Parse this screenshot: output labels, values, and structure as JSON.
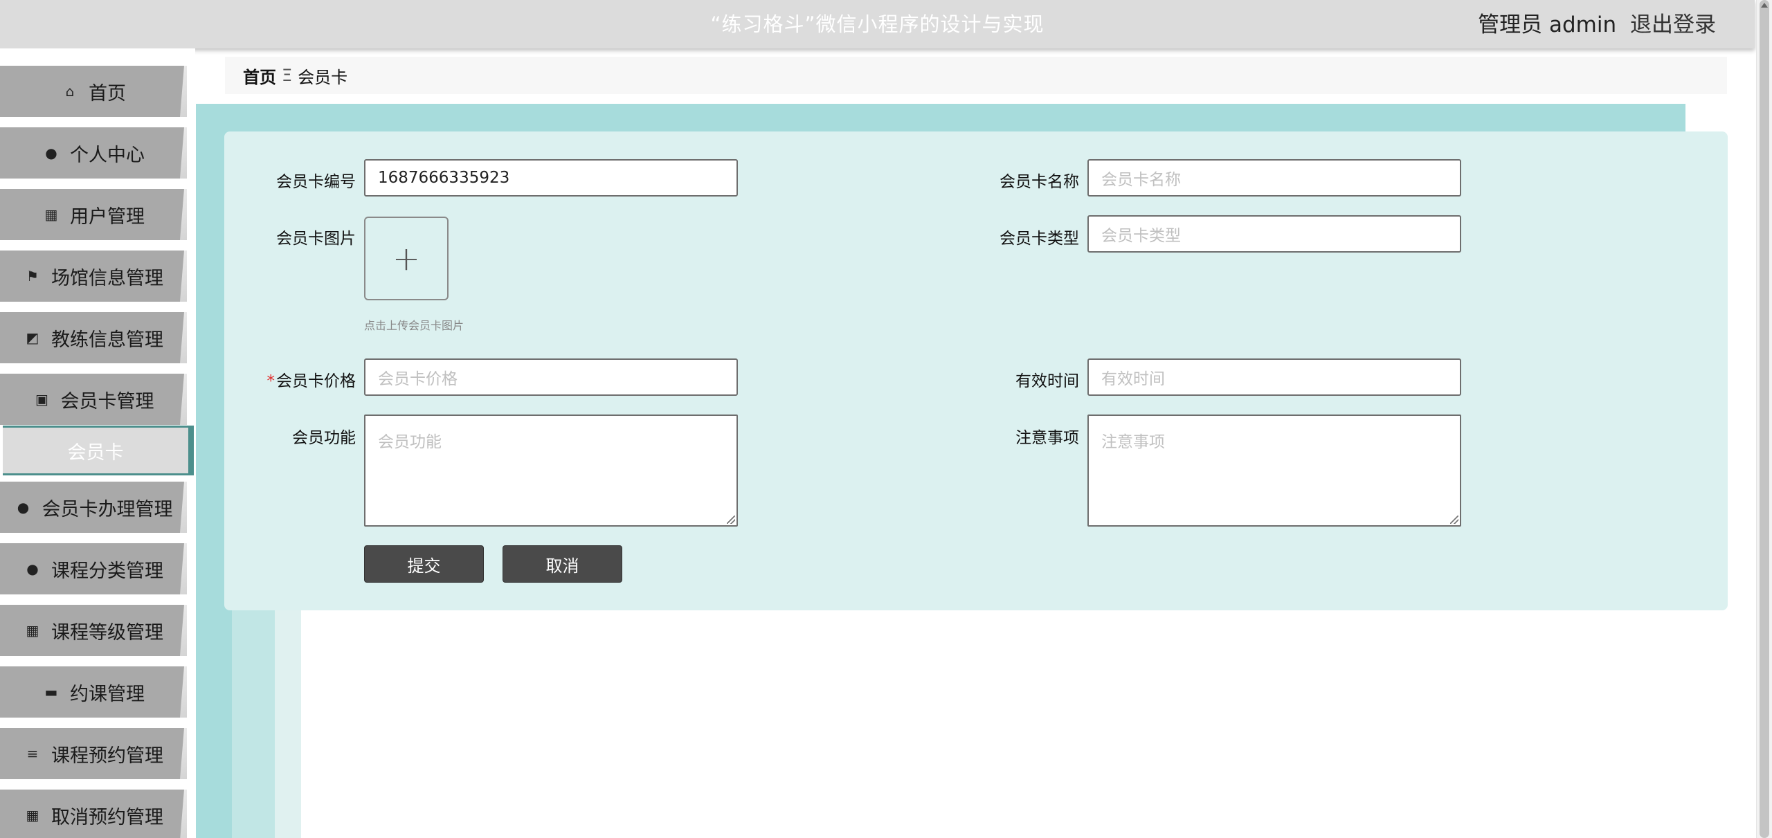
{
  "header": {
    "title": "“练习格斗”微信小程序的设计与实现",
    "user_label": "管理员 admin",
    "logout_label": "退出登录"
  },
  "sidebar": {
    "items": [
      {
        "label": "首页",
        "icon": "home-icon",
        "glyph": "⌂"
      },
      {
        "label": "个人中心",
        "icon": "user-icon",
        "glyph": "●"
      },
      {
        "label": "用户管理",
        "icon": "grid-icon",
        "glyph": "▦"
      },
      {
        "label": "场馆信息管理",
        "icon": "flag-icon",
        "glyph": "⚑"
      },
      {
        "label": "教练信息管理",
        "icon": "chart-icon",
        "glyph": "◩"
      },
      {
        "label": "会员卡管理",
        "icon": "clipboard-icon",
        "glyph": "▣"
      },
      {
        "label": "会员卡办理管理",
        "icon": "bulb-icon",
        "glyph": "●"
      },
      {
        "label": "课程分类管理",
        "icon": "user-icon",
        "glyph": "●"
      },
      {
        "label": "课程等级管理",
        "icon": "grid-icon",
        "glyph": "▦"
      },
      {
        "label": "约课管理",
        "icon": "briefcase-icon",
        "glyph": "▬"
      },
      {
        "label": "课程预约管理",
        "icon": "list-icon",
        "glyph": "≡"
      },
      {
        "label": "取消预约管理",
        "icon": "grid-icon",
        "glyph": "▦"
      }
    ],
    "sub_active": "会员卡"
  },
  "breadcrumb": {
    "home": "首页",
    "separator": "Ξ",
    "current": "会员卡"
  },
  "form": {
    "card_no_label": "会员卡编号",
    "card_no_value": "1687666335923",
    "card_name_label": "会员卡名称",
    "card_name_placeholder": "会员卡名称",
    "card_image_label": "会员卡图片",
    "upload_hint": "点击上传会员卡图片",
    "card_type_label": "会员卡类型",
    "card_type_placeholder": "会员卡类型",
    "required_mark": "*",
    "price_label": "会员卡价格",
    "price_placeholder": "会员卡价格",
    "valid_time_label": "有效时间",
    "valid_time_placeholder": "有效时间",
    "features_label": "会员功能",
    "features_placeholder": "会员功能",
    "notes_label": "注意事项",
    "notes_placeholder": "注意事项",
    "submit_label": "提交",
    "cancel_label": "取消"
  },
  "colors": {
    "sidebar_item": "#a9a9a9",
    "accent_teal": "#a7dcdc",
    "form_bg": "#dcf1f0",
    "button": "#4a4a4a",
    "required": "#e0302f"
  }
}
